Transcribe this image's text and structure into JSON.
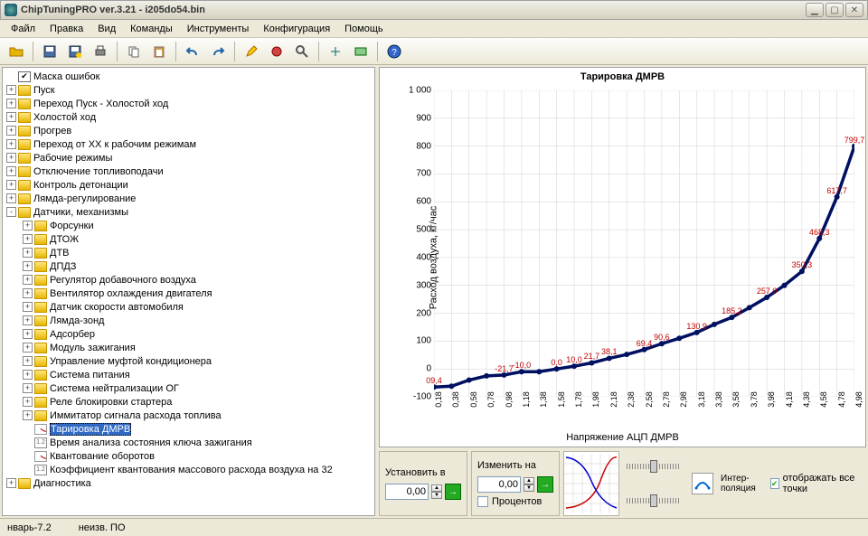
{
  "window": {
    "title": "ChipTuningPRO ver.3.21 - i205do54.bin"
  },
  "menu": [
    "Файл",
    "Правка",
    "Вид",
    "Команды",
    "Инструменты",
    "Конфигурация",
    "Помощь"
  ],
  "tree": [
    {
      "lvl": 1,
      "exp": "",
      "icon": "ck",
      "label": "Маска ошибок"
    },
    {
      "lvl": 1,
      "exp": "+",
      "icon": "f",
      "label": "Пуск"
    },
    {
      "lvl": 1,
      "exp": "+",
      "icon": "f",
      "label": "Переход Пуск - Холостой ход"
    },
    {
      "lvl": 1,
      "exp": "+",
      "icon": "f",
      "label": "Холостой ход"
    },
    {
      "lvl": 1,
      "exp": "+",
      "icon": "f",
      "label": "Прогрев"
    },
    {
      "lvl": 1,
      "exp": "+",
      "icon": "f",
      "label": "Переход от ХХ к рабочим режимам"
    },
    {
      "lvl": 1,
      "exp": "+",
      "icon": "f",
      "label": "Рабочие режимы"
    },
    {
      "lvl": 1,
      "exp": "+",
      "icon": "f",
      "label": "Отключение топливоподачи"
    },
    {
      "lvl": 1,
      "exp": "+",
      "icon": "f",
      "label": "Контроль детонации"
    },
    {
      "lvl": 1,
      "exp": "+",
      "icon": "f",
      "label": "Лямда-регулирование"
    },
    {
      "lvl": 1,
      "exp": "-",
      "icon": "f",
      "label": "Датчики, механизмы"
    },
    {
      "lvl": 2,
      "exp": "+",
      "icon": "f",
      "label": "Форсунки"
    },
    {
      "lvl": 2,
      "exp": "+",
      "icon": "f",
      "label": "ДТОЖ"
    },
    {
      "lvl": 2,
      "exp": "+",
      "icon": "f",
      "label": "ДТВ"
    },
    {
      "lvl": 2,
      "exp": "+",
      "icon": "f",
      "label": "ДПДЗ"
    },
    {
      "lvl": 2,
      "exp": "+",
      "icon": "f",
      "label": "Регулятор добавочного воздуха"
    },
    {
      "lvl": 2,
      "exp": "+",
      "icon": "f",
      "label": "Вентилятор охлаждения двигателя"
    },
    {
      "lvl": 2,
      "exp": "+",
      "icon": "f",
      "label": "Датчик скорости автомобиля"
    },
    {
      "lvl": 2,
      "exp": "+",
      "icon": "f",
      "label": "Лямда-зонд"
    },
    {
      "lvl": 2,
      "exp": "+",
      "icon": "f",
      "label": "Адсорбер"
    },
    {
      "lvl": 2,
      "exp": "+",
      "icon": "f",
      "label": "Модуль зажигания"
    },
    {
      "lvl": 2,
      "exp": "+",
      "icon": "f",
      "label": "Управление муфтой кондиционера"
    },
    {
      "lvl": 2,
      "exp": "+",
      "icon": "f",
      "label": "Система питания"
    },
    {
      "lvl": 2,
      "exp": "+",
      "icon": "f",
      "label": "Система нейтрализации ОГ"
    },
    {
      "lvl": 2,
      "exp": "+",
      "icon": "f",
      "label": "Реле блокировки стартера"
    },
    {
      "lvl": 2,
      "exp": "+",
      "icon": "f",
      "label": "Иммитатор сигнала расхода топлива"
    },
    {
      "lvl": 2,
      "exp": "",
      "icon": "cv",
      "label": "Тарировка ДМРВ",
      "sel": true
    },
    {
      "lvl": 2,
      "exp": "",
      "icon": "12",
      "label": "Время анализа состояния ключа зажигания"
    },
    {
      "lvl": 2,
      "exp": "",
      "icon": "cv",
      "label": "Квантование оборотов"
    },
    {
      "lvl": 2,
      "exp": "",
      "icon": "12",
      "label": "Коэффициент квантования массового расхода воздуха на 32"
    },
    {
      "lvl": 1,
      "exp": "+",
      "icon": "f",
      "label": "Диагностика"
    }
  ],
  "chart_data": {
    "type": "line",
    "title": "Тарировка ДМРВ",
    "xlabel": "Напряжение АЦП ДМРВ",
    "ylabel": "Расход воздуха, кг/час",
    "ylim": [
      -100,
      1000
    ],
    "yticks": [
      -100,
      0,
      100,
      200,
      300,
      400,
      500,
      600,
      700,
      800,
      900,
      1000
    ],
    "xticks": [
      "0,18",
      "0,38",
      "0,58",
      "0,78",
      "0,98",
      "1,18",
      "1,38",
      "1,58",
      "1,78",
      "1,98",
      "2,18",
      "2,38",
      "2,58",
      "2,78",
      "2,98",
      "3,18",
      "3,38",
      "3,58",
      "3,78",
      "3,98",
      "4,18",
      "4,38",
      "4,58",
      "4,78",
      "4,98"
    ],
    "x": [
      0.18,
      0.38,
      0.58,
      0.78,
      0.98,
      1.18,
      1.38,
      1.58,
      1.78,
      1.98,
      2.18,
      2.38,
      2.58,
      2.78,
      2.98,
      3.18,
      3.38,
      3.58,
      3.78,
      3.98,
      4.18,
      4.38,
      4.58,
      4.78,
      4.98
    ],
    "values": [
      -65,
      -62,
      -40,
      -25,
      -21.7,
      -10.0,
      -10.0,
      0.0,
      10.0,
      21.7,
      38.1,
      52,
      69.4,
      90.6,
      110,
      130.9,
      160,
      185.2,
      220,
      257.0,
      300,
      350.3,
      468.3,
      617.7,
      799.7
    ],
    "labels": [
      {
        "x": 0.18,
        "y": -65,
        "t": "09,4"
      },
      {
        "x": 0.98,
        "y": -21.7,
        "t": "-21,7"
      },
      {
        "x": 1.18,
        "y": -10.0,
        "t": "-10,0"
      },
      {
        "x": 1.58,
        "y": 0.0,
        "t": "0,0"
      },
      {
        "x": 1.78,
        "y": 10.0,
        "t": "10,0"
      },
      {
        "x": 1.98,
        "y": 21.7,
        "t": "21,7"
      },
      {
        "x": 2.18,
        "y": 38.1,
        "t": "38,1"
      },
      {
        "x": 2.58,
        "y": 69.4,
        "t": "69,4"
      },
      {
        "x": 2.78,
        "y": 90.6,
        "t": "90,6"
      },
      {
        "x": 3.18,
        "y": 130.9,
        "t": "130,9"
      },
      {
        "x": 3.58,
        "y": 185.2,
        "t": "185,2"
      },
      {
        "x": 3.98,
        "y": 257.0,
        "t": "257,0"
      },
      {
        "x": 4.38,
        "y": 350.3,
        "t": "350,3"
      },
      {
        "x": 4.58,
        "y": 468.3,
        "t": "468,3"
      },
      {
        "x": 4.78,
        "y": 617.7,
        "t": "617,7"
      },
      {
        "x": 4.98,
        "y": 799.7,
        "t": "799,7"
      }
    ]
  },
  "controls": {
    "set_label": "Установить в",
    "set_value": "0,00",
    "change_label": "Изменить на",
    "change_value": "0,00",
    "percent_label": "Процентов",
    "interp_label": "Интер-\nполяция",
    "showall_label": "отображать все точки",
    "showall_checked": true
  },
  "status": {
    "left": "нварь-7.2",
    "right": "неизв. ПО"
  }
}
